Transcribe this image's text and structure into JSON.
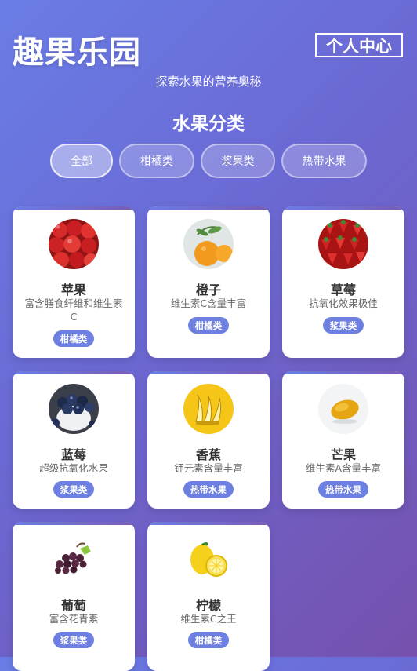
{
  "header": {
    "title": "趣果乐园",
    "profile_label": "个人中心",
    "subtitle": "探索水果的营养奥秘"
  },
  "section_title": "水果分类",
  "filters": [
    {
      "label": "全部",
      "active": true
    },
    {
      "label": "柑橘类"
    },
    {
      "label": "浆果类"
    },
    {
      "label": "热带水果"
    }
  ],
  "fruits": [
    {
      "name": "苹果",
      "desc": "富含膳食纤维和维生素C",
      "tag": "柑橘类",
      "image": "apple-image"
    },
    {
      "name": "橙子",
      "desc": "维生素C含量丰富",
      "tag": "柑橘类",
      "image": "orange-image"
    },
    {
      "name": "草莓",
      "desc": "抗氧化效果极佳",
      "tag": "浆果类",
      "image": "strawberry-image"
    },
    {
      "name": "蓝莓",
      "desc": "超级抗氧化水果",
      "tag": "浆果类",
      "image": "blueberry-image"
    },
    {
      "name": "香蕉",
      "desc": "钾元素含量丰富",
      "tag": "热带水果",
      "image": "banana-image"
    },
    {
      "name": "芒果",
      "desc": "维生素A含量丰富",
      "tag": "热带水果",
      "image": "mango-image"
    },
    {
      "name": "葡萄",
      "desc": "富含花青素",
      "tag": "浆果类",
      "image": "grape-image"
    },
    {
      "name": "柠檬",
      "desc": "维生素C之王",
      "tag": "柑橘类",
      "image": "lemon-image"
    }
  ],
  "colors": {
    "bg_start": "#6a7de6",
    "bg_end": "#7651ad",
    "tag_bg": "#6d7fe0"
  }
}
